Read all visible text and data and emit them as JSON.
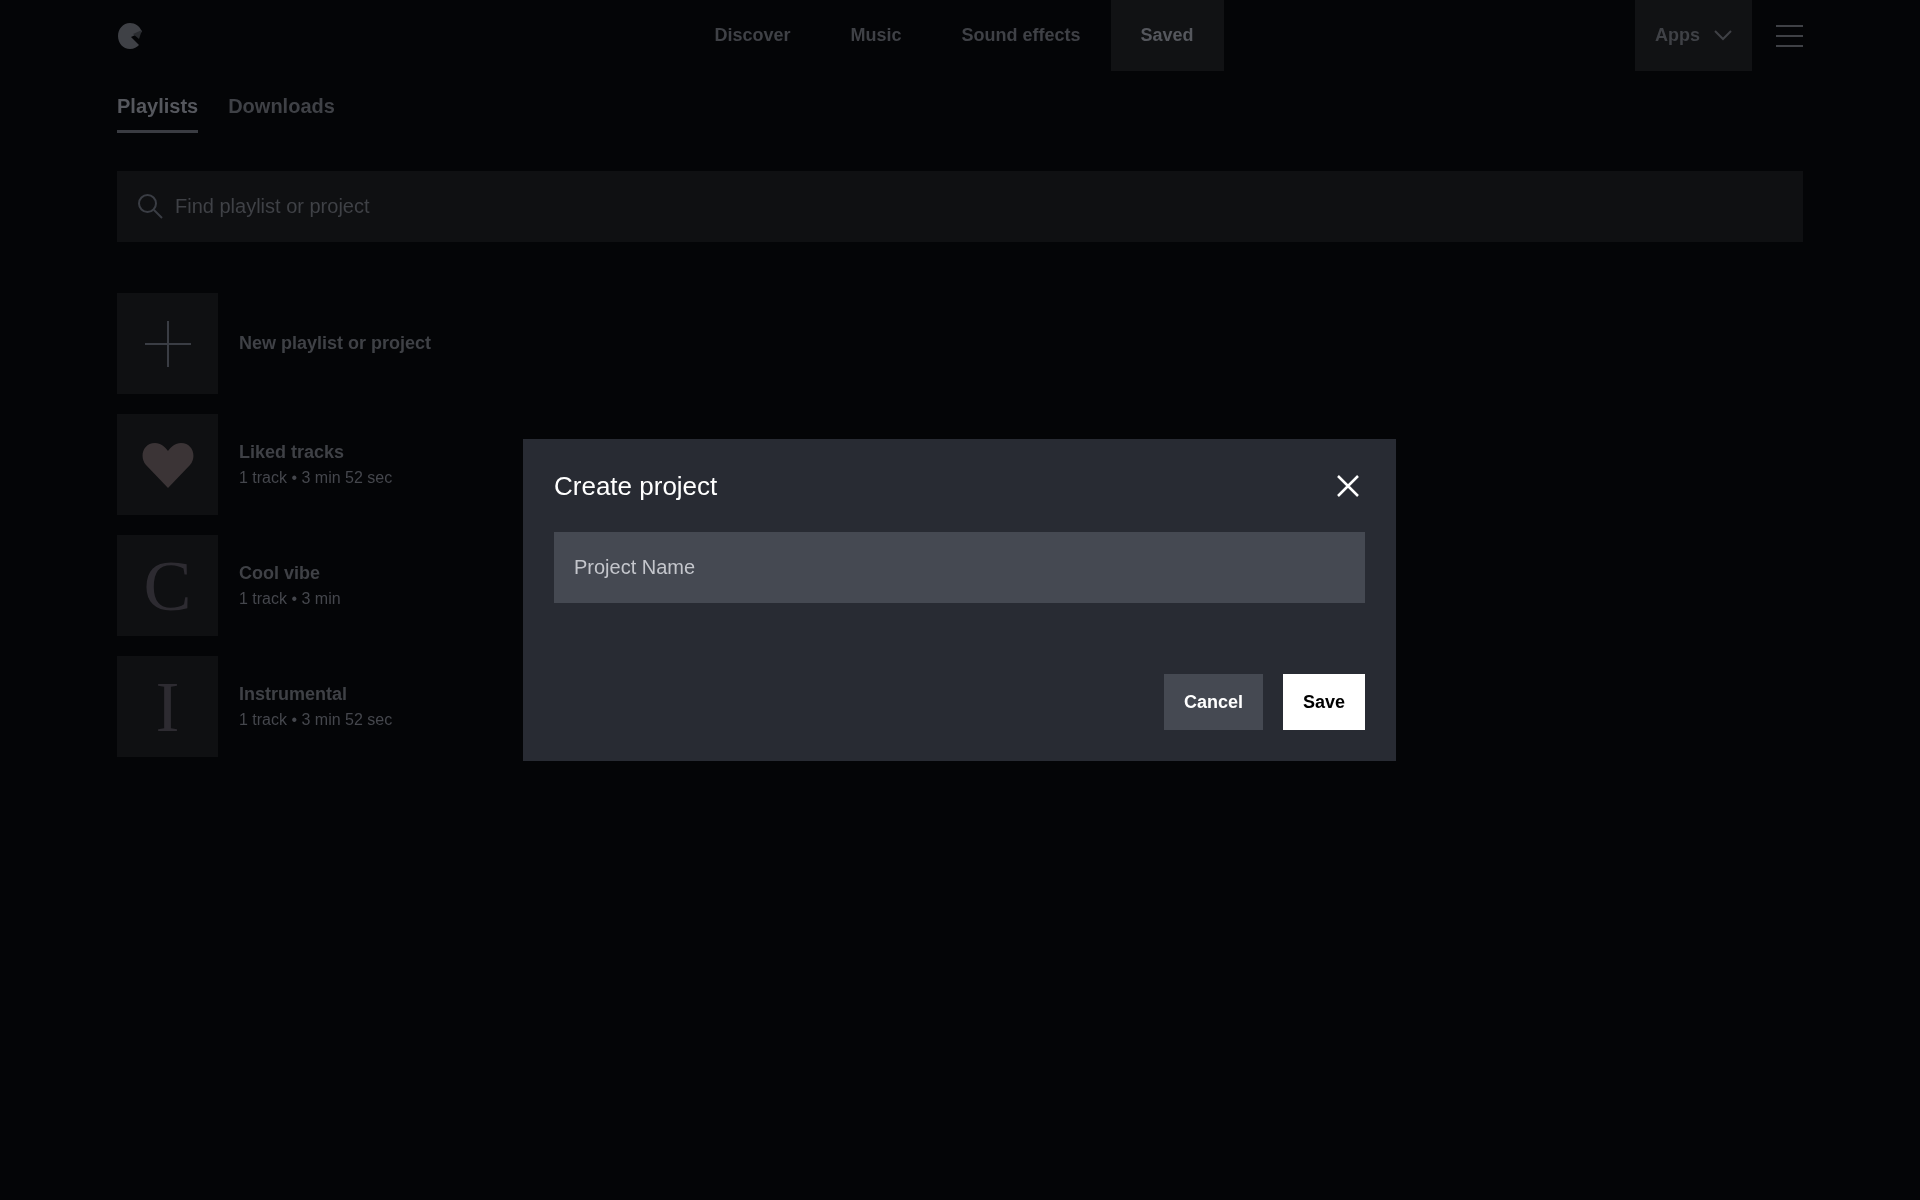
{
  "nav": {
    "items": [
      {
        "label": "Discover",
        "selected": false
      },
      {
        "label": "Music",
        "selected": false
      },
      {
        "label": "Sound effects",
        "selected": false
      },
      {
        "label": "Saved",
        "selected": true
      }
    ],
    "apps": "Apps"
  },
  "tabs": [
    {
      "label": "Playlists",
      "selected": true
    },
    {
      "label": "Downloads",
      "selected": false
    }
  ],
  "search": {
    "placeholder": "Find playlist or project"
  },
  "playlists": [
    {
      "kind": "new",
      "title": "New playlist or project"
    },
    {
      "kind": "liked",
      "title": "Liked tracks",
      "meta": "1 track • 3 min 52 sec"
    },
    {
      "kind": "letter",
      "initial": "C",
      "title": "Cool vibe",
      "meta": "1 track • 3 min"
    },
    {
      "kind": "letter",
      "initial": "I",
      "title": "Instrumental",
      "meta": "1 track • 3 min 52 sec"
    }
  ],
  "dialog": {
    "title": "Create project",
    "field": {
      "placeholder": "Project Name"
    },
    "buttons": [
      {
        "label": "Cancel",
        "kind": "secondary"
      },
      {
        "label": "Save",
        "kind": "primary"
      }
    ]
  }
}
